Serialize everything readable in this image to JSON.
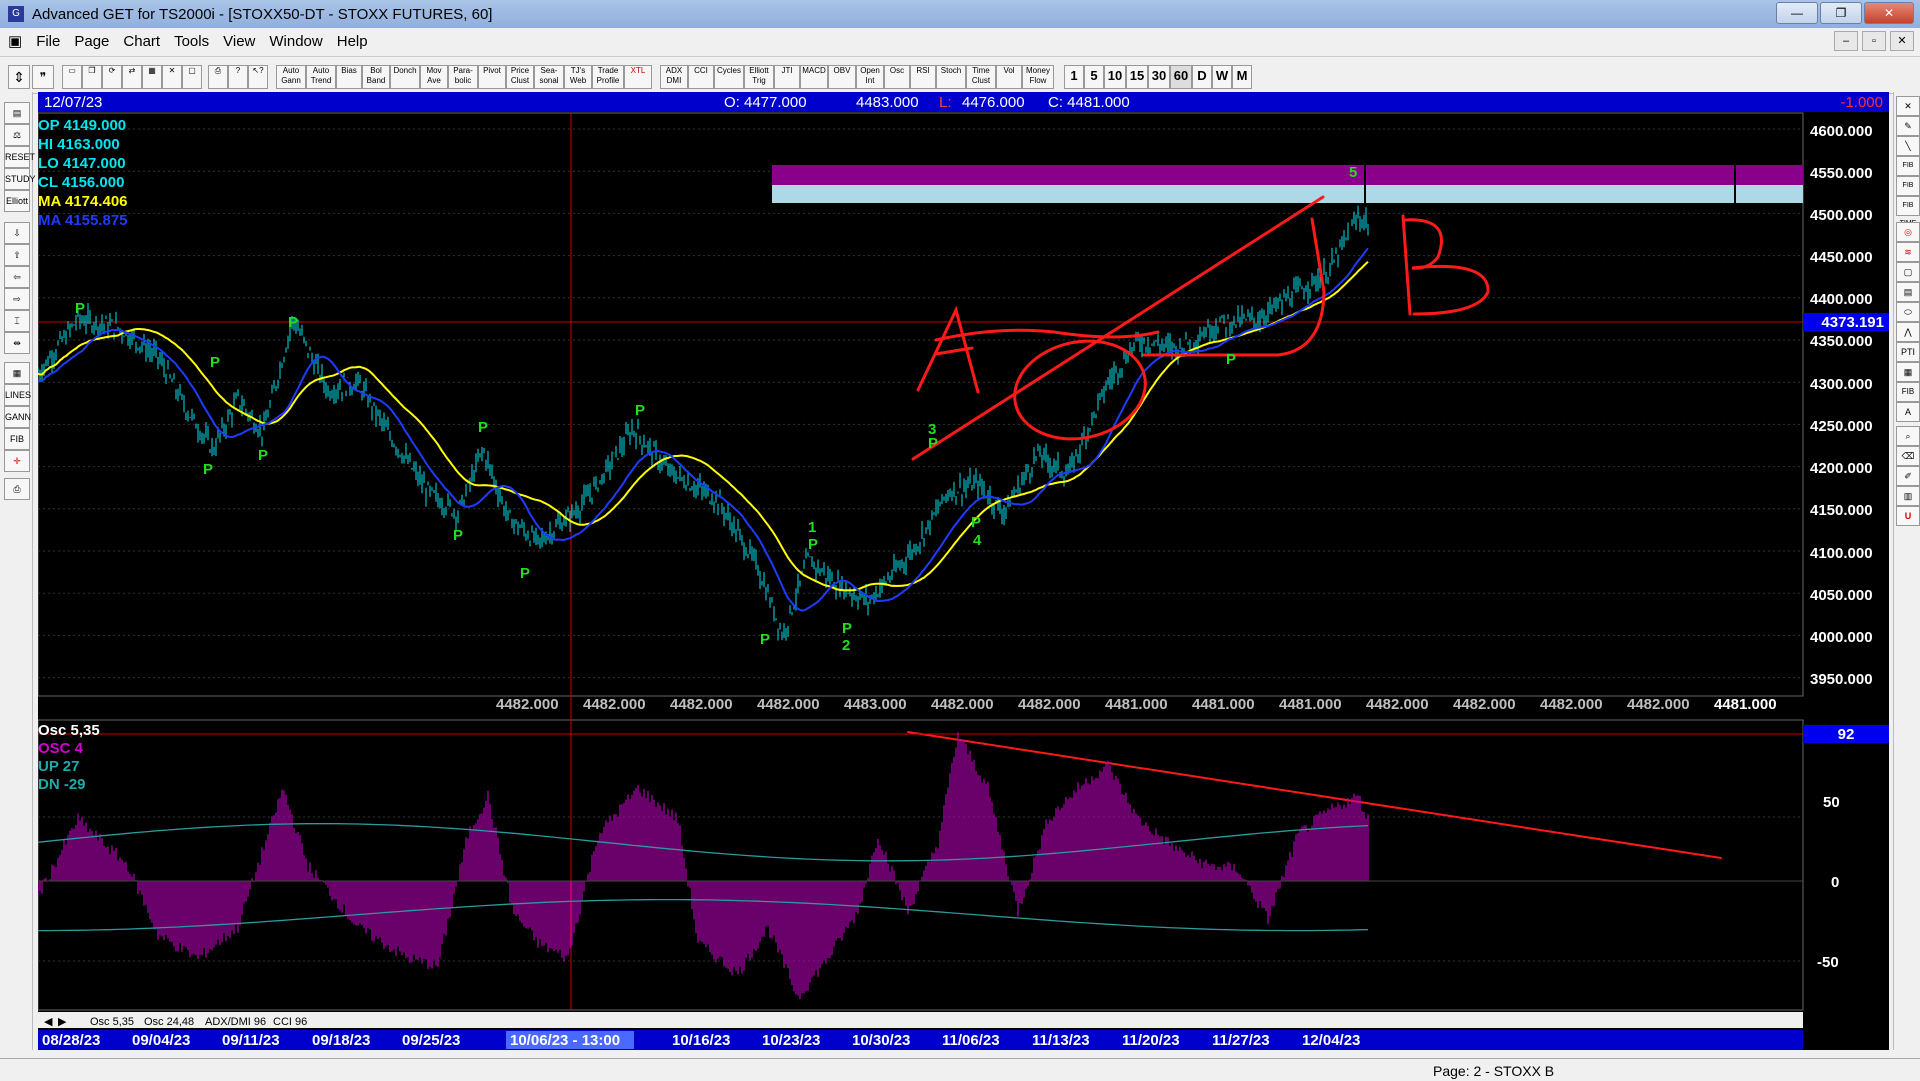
{
  "window": {
    "title": "Advanced GET for TS2000i - [STOXX50-DT - STOXX FUTURES, 60]",
    "buttons": [
      "—",
      "❐",
      "✕"
    ]
  },
  "menu": [
    "File",
    "Page",
    "Chart",
    "Tools",
    "View",
    "Window",
    "Help"
  ],
  "mdi_buttons": [
    "–",
    "▫",
    "✕"
  ],
  "toolbar": {
    "indicator_buttons": [
      "Auto Gann",
      "Auto Trend",
      "Bias",
      "Bol Band",
      "Donch",
      "Mov Ave",
      "Para-bolic",
      "Pivot",
      "Price Clust",
      "Sea-sonal",
      "TJ's Web",
      "Trade Profile",
      "XTL",
      "ADX DMI",
      "CCI",
      "Cycles",
      "Elliott Trig",
      "JTI",
      "MACD",
      "OBV",
      "Open Int",
      "Osc",
      "RSI",
      "Stoch",
      "Time Clust",
      "Vol",
      "Money Flow"
    ],
    "timeframes": [
      "1",
      "5",
      "10",
      "15",
      "30",
      "60",
      "D",
      "W",
      "M"
    ]
  },
  "left_tools": [
    "Elliott",
    "RESET",
    "STUDY",
    "LINES",
    "GANN",
    "FIB"
  ],
  "right_tools": [
    "FIB RET",
    "FIB EXT",
    "FIB TIME",
    "PTI",
    "FIB",
    "U"
  ],
  "header": {
    "date": "12/07/23",
    "open": "O: 4477.000",
    "high": "4483.000",
    "low_label": "L:",
    "low": "4476.000",
    "close": "C: 4481.000",
    "change": "-1.000"
  },
  "legend": {
    "op": "OP  4149.000",
    "hi": "HI   4163.000",
    "lo": "LO  4147.000",
    "cl": "CL  4156.000",
    "ma1": "MA  4174.406",
    "ma2": "MA  4155.875"
  },
  "price_axis": [
    "4600.000",
    "4550.000",
    "4500.000",
    "4450.000",
    "4400.000",
    "4350.000",
    "4300.000",
    "4250.000",
    "4200.000",
    "4150.000",
    "4100.000",
    "4050.000",
    "4000.000",
    "3950.000"
  ],
  "current_price": "4373.191",
  "bottom_values": [
    "4482.000",
    "4482.000",
    "4482.000",
    "4482.000",
    "4483.000",
    "4482.000",
    "4482.000",
    "4481.000",
    "4481.000",
    "4481.000",
    "4482.000",
    "4482.000",
    "4482.000",
    "4482.000",
    "4481.000"
  ],
  "osc_legend": {
    "title": "Osc 5,35",
    "osc": "OSC 4",
    "up": "UP   27",
    "dn": "DN   -29"
  },
  "osc_axis": [
    "92",
    "50",
    "0",
    "-50"
  ],
  "osc_tabs": [
    "Osc 5,35",
    "Osc 24,48",
    "ADX/DMI 96",
    "CCI 96"
  ],
  "date_axis": [
    "08/28/23",
    "09/04/23",
    "09/11/23",
    "09/18/23",
    "09/25/23",
    "10/06/23 - 13:00",
    "10/16/23",
    "10/23/23",
    "10/30/23",
    "11/06/23",
    "11/13/23",
    "11/20/23",
    "11/27/23",
    "12/04/23"
  ],
  "elliott_labels": [
    "P",
    "P",
    "P",
    "P",
    "P",
    "P",
    "P",
    "P",
    "P",
    "P",
    "1",
    "P",
    "P",
    "2",
    "3",
    "P",
    "P",
    "4",
    "P",
    "5"
  ],
  "annotations": [
    "A",
    "B"
  ],
  "status": {
    "page": "Page: 2 - STOXX B"
  },
  "colors": {
    "price_bars": "#00e5ee",
    "ma_yellow": "#ffff00",
    "ma_blue": "#1e3cff",
    "oscillator": "#b000b0",
    "drawing_red": "#ff0000",
    "elliott_green": "#22dd22",
    "zone_purple": "#8b008b",
    "zone_lightblue": "#add8e6"
  }
}
